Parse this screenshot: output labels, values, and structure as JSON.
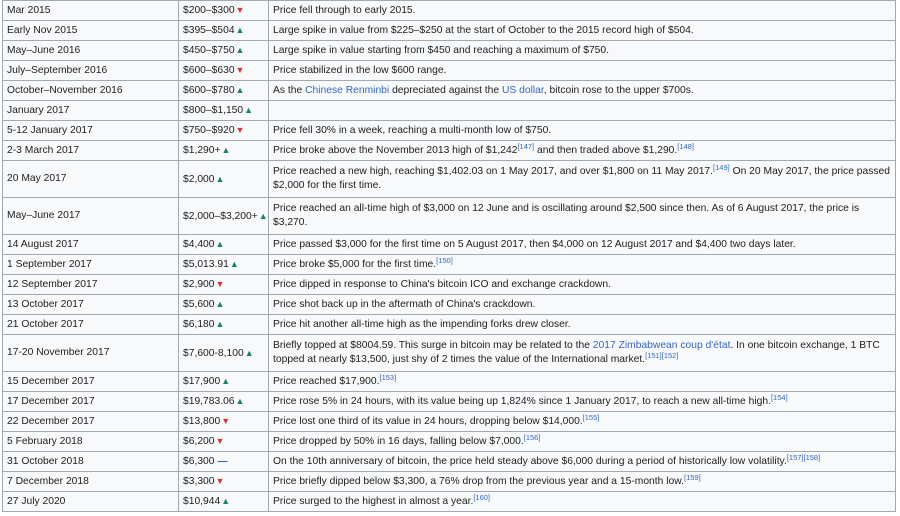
{
  "colors": {
    "up": "#14866d",
    "down": "#dd3333",
    "flat": "#3366cc",
    "link": "#3366cc",
    "border": "#a2a9b1",
    "cell_bg": "#f8f9fa"
  },
  "rows": [
    {
      "date": "Mar 2015",
      "price": "$200–$300",
      "trend": "down",
      "desc": [
        {
          "t": "Price fell through to early 2015."
        }
      ]
    },
    {
      "date": "Early Nov 2015",
      "price": "$395–$504",
      "trend": "up",
      "desc": [
        {
          "t": "Large spike in value from $225–$250 at the start of October to the 2015 record high of $504."
        }
      ]
    },
    {
      "date": "May–June 2016",
      "price": "$450–$750",
      "trend": "up",
      "desc": [
        {
          "t": "Large spike in value starting from $450 and reaching a maximum of $750."
        }
      ]
    },
    {
      "date": "July–September 2016",
      "price": "$600–$630",
      "trend": "down",
      "desc": [
        {
          "t": "Price stabilized in the low $600 range."
        }
      ]
    },
    {
      "date": "October–November 2016",
      "price": "$600–$780",
      "trend": "up",
      "desc": [
        {
          "t": "As the "
        },
        {
          "t": "Chinese Renminbi",
          "link": true
        },
        {
          "t": " depreciated against the "
        },
        {
          "t": "US dollar",
          "link": true
        },
        {
          "t": ", bitcoin rose to the upper $700s."
        }
      ]
    },
    {
      "date": "January 2017",
      "price": "$800–$1,150",
      "trend": "up",
      "desc": []
    },
    {
      "date": "5-12 January 2017",
      "price": "$750–$920",
      "trend": "down",
      "desc": [
        {
          "t": "Price fell 30% in a week, reaching a multi-month low of $750."
        }
      ]
    },
    {
      "date": "2-3 March 2017",
      "price": "$1,290+",
      "trend": "up",
      "desc": [
        {
          "t": "Price broke above the November 2013 high of $1,242"
        },
        {
          "t": "[147]",
          "ref": true
        },
        {
          "t": " and then traded above $1,290."
        },
        {
          "t": "[148]",
          "ref": true
        }
      ]
    },
    {
      "date": "20 May 2017",
      "price": "$2,000",
      "trend": "up",
      "desc": [
        {
          "t": "Price reached a new high, reaching $1,402.03 on 1 May 2017, and over $1,800 on 11 May 2017."
        },
        {
          "t": "[149]",
          "ref": true
        },
        {
          "t": " On 20 May 2017, the price passed $2,000 for the first time."
        }
      ]
    },
    {
      "date": "May–June 2017",
      "price": "$2,000–$3,200+",
      "trend": "up",
      "desc": [
        {
          "t": "Price reached an all-time high of $3,000 on 12 June and is oscillating around $2,500 since then. As of 6 August 2017, the price is $3,270."
        }
      ]
    },
    {
      "date": "14 August 2017",
      "price": "$4,400",
      "trend": "up",
      "desc": [
        {
          "t": "Price passed $3,000 for the first time on 5 August 2017, then $4,000 on 12 August 2017 and $4,400 two days later."
        }
      ]
    },
    {
      "date": "1 September 2017",
      "price": "$5,013.91",
      "trend": "up",
      "desc": [
        {
          "t": "Price broke $5,000 for the first time."
        },
        {
          "t": "[150]",
          "ref": true
        }
      ]
    },
    {
      "date": "12 September 2017",
      "price": "$2,900",
      "trend": "down",
      "desc": [
        {
          "t": "Price dipped in response to China's bitcoin ICO and exchange crackdown."
        }
      ]
    },
    {
      "date": "13 October 2017",
      "price": "$5,600",
      "trend": "up",
      "desc": [
        {
          "t": "Price shot back up in the aftermath of China's crackdown."
        }
      ]
    },
    {
      "date": "21 October 2017",
      "price": "$6,180",
      "trend": "up",
      "desc": [
        {
          "t": "Price hit another all-time high as the impending forks drew closer."
        }
      ]
    },
    {
      "date": "17-20 November 2017",
      "price": "$7,600-8,100",
      "trend": "up",
      "desc": [
        {
          "t": "Briefly topped at $8004.59. This surge in bitcoin may be related to the "
        },
        {
          "t": "2017 Zimbabwean coup d'état",
          "link": true
        },
        {
          "t": ". In one bitcoin exchange, 1 BTC topped at nearly $13,500, just shy of 2 times the value of the International market."
        },
        {
          "t": "[151][152]",
          "ref": true
        }
      ]
    },
    {
      "date": "15 December 2017",
      "price": "$17,900",
      "trend": "up",
      "desc": [
        {
          "t": "Price reached $17,900."
        },
        {
          "t": "[153]",
          "ref": true
        }
      ]
    },
    {
      "date": "17 December 2017",
      "price": "$19,783.06",
      "trend": "up",
      "desc": [
        {
          "t": "Price rose 5% in 24 hours, with its value being up 1,824% since 1 January 2017, to reach a new all-time high."
        },
        {
          "t": "[154]",
          "ref": true
        }
      ]
    },
    {
      "date": "22 December 2017",
      "price": "$13,800",
      "trend": "down",
      "desc": [
        {
          "t": "Price lost one third of its value in 24 hours, dropping below $14,000."
        },
        {
          "t": "[155]",
          "ref": true
        }
      ]
    },
    {
      "date": "5 February 2018",
      "price": "$6,200",
      "trend": "down",
      "desc": [
        {
          "t": "Price dropped by 50% in 16 days, falling below $7,000."
        },
        {
          "t": "[156]",
          "ref": true
        }
      ]
    },
    {
      "date": "31 October 2018",
      "price": "$6,300",
      "trend": "flat",
      "desc": [
        {
          "t": "On the 10th anniversary of bitcoin, the price held steady above $6,000 during a period of historically low volatility."
        },
        {
          "t": "[157][158]",
          "ref": true
        }
      ]
    },
    {
      "date": "7 December 2018",
      "price": "$3,300",
      "trend": "down",
      "desc": [
        {
          "t": "Price briefly dipped below $3,300, a 76% drop from the previous year and a 15-month low."
        },
        {
          "t": "[159]",
          "ref": true
        }
      ]
    },
    {
      "date": "27 July 2020",
      "price": "$10,944",
      "trend": "up",
      "desc": [
        {
          "t": "Price surged to the highest in almost a year."
        },
        {
          "t": "[160]",
          "ref": true
        }
      ]
    }
  ]
}
